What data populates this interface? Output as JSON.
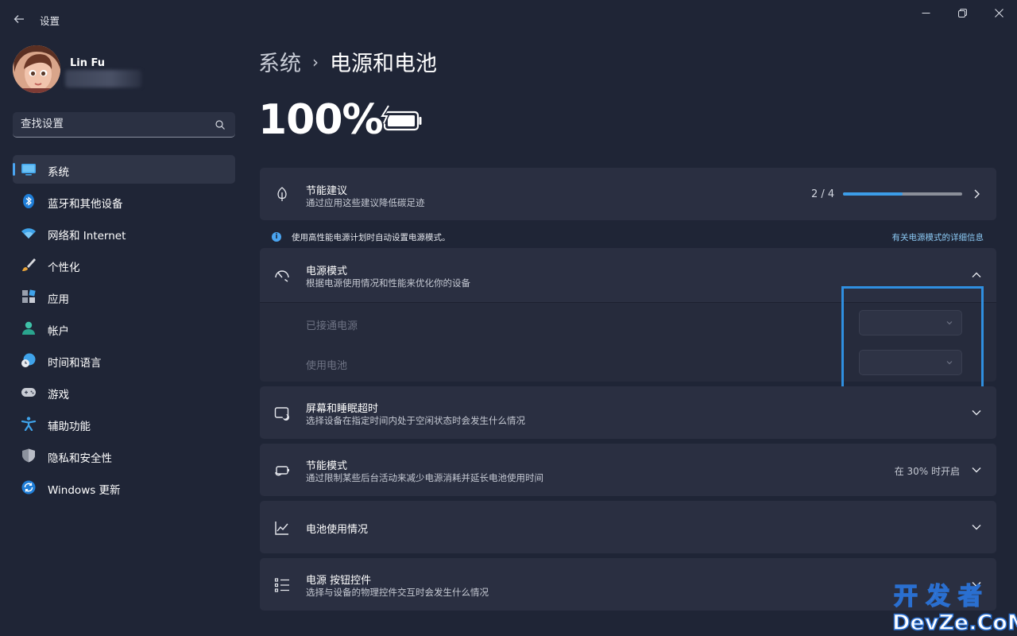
{
  "window": {
    "title": "设置",
    "controls": {
      "minimize": "—",
      "maximize": "❐",
      "close": "✕"
    }
  },
  "profile": {
    "name": "Lin Fu"
  },
  "search": {
    "placeholder": "查找设置"
  },
  "sidebar": {
    "items": [
      {
        "label": "系统",
        "icon": "monitor-icon",
        "active": true
      },
      {
        "label": "蓝牙和其他设备",
        "icon": "bluetooth-icon"
      },
      {
        "label": "网络和 Internet",
        "icon": "wifi-icon"
      },
      {
        "label": "个性化",
        "icon": "brush-icon"
      },
      {
        "label": "应用",
        "icon": "apps-icon"
      },
      {
        "label": "帐户",
        "icon": "person-icon"
      },
      {
        "label": "时间和语言",
        "icon": "globe-clock-icon"
      },
      {
        "label": "游戏",
        "icon": "gamepad-icon"
      },
      {
        "label": "辅助功能",
        "icon": "accessibility-icon"
      },
      {
        "label": "隐私和安全性",
        "icon": "shield-icon"
      },
      {
        "label": "Windows 更新",
        "icon": "update-icon"
      }
    ]
  },
  "breadcrumb": {
    "parent": "系统",
    "separator": "›",
    "current": "电源和电池"
  },
  "battery": {
    "percent": "100%",
    "charging": true
  },
  "energy_recommendations": {
    "title": "节能建议",
    "subtitle": "通过应用这些建议降低碳足迹",
    "progress_text": "2 / 4",
    "progress_fraction": 0.5
  },
  "info_bar": {
    "icon": "i",
    "text": "使用高性能电源计划时自动设置电源模式。",
    "link": "有关电源模式的详细信息"
  },
  "power_mode": {
    "title": "电源模式",
    "subtitle": "根据电源使用情况和性能来优化你的设备",
    "plugged_in_label": "已接通电源",
    "on_battery_label": "使用电池"
  },
  "screen_sleep": {
    "title": "屏幕和睡眠超时",
    "subtitle": "选择设备在指定时间内处于空闲状态时会发生什么情况"
  },
  "battery_saver": {
    "title": "节能模式",
    "subtitle": "通过限制某些后台活动来减少电源消耗并延长电池使用时间",
    "status": "在 30% 时开启"
  },
  "battery_usage": {
    "title": "电池使用情况"
  },
  "power_buttons": {
    "title": "电源 按钮控件",
    "subtitle": "选择与设备的物理控件交互时会发生什么情况"
  },
  "watermark": {
    "line1": "开 发 者",
    "line2": "DevZe.CoM"
  },
  "colors": {
    "background": "#1f2536",
    "card": "#2a2f41",
    "accent": "#3c9de8",
    "highlight_box": "#2f8fe0",
    "link": "#8ccaf5"
  }
}
